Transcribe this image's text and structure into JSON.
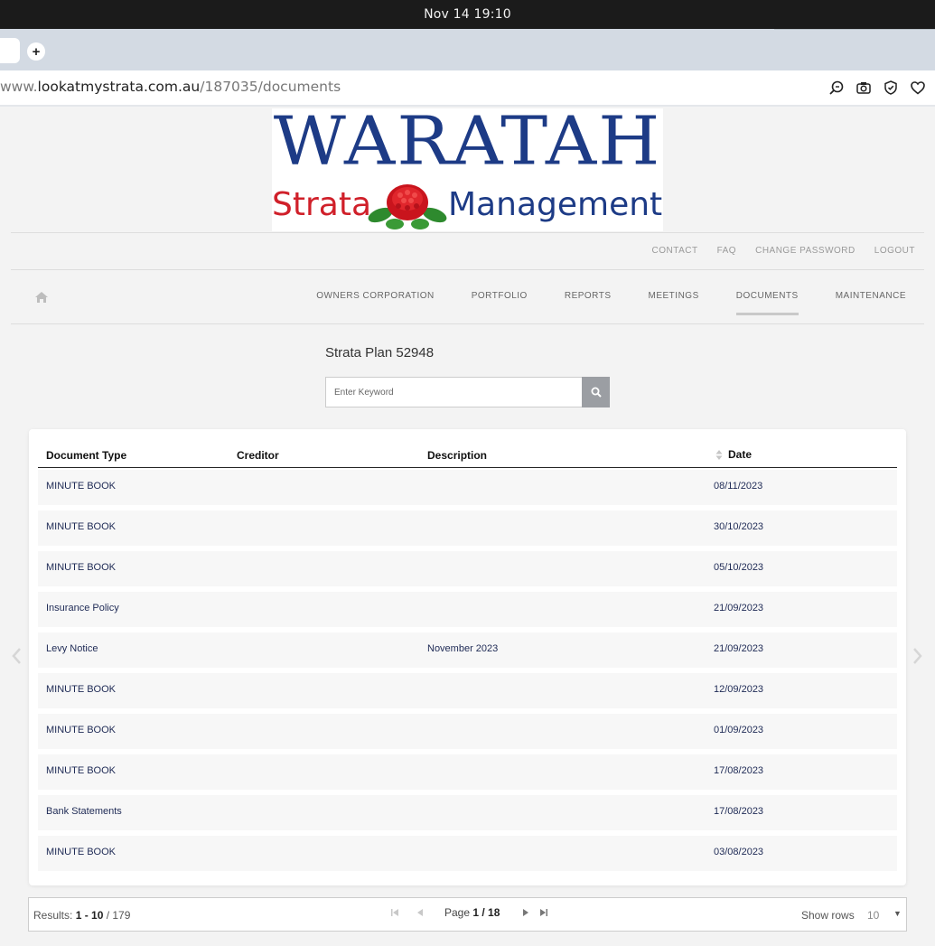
{
  "os": {
    "clock": "Nov 14  19:10"
  },
  "browser": {
    "new_tab_glyph": "+",
    "url_prefix": "www.",
    "url_host": "lookatmystrata.com.au",
    "url_path": "/187035/documents"
  },
  "logo": {
    "line1": "WARATAH",
    "strata": "Strata",
    "management": "Management"
  },
  "util_nav": [
    "CONTACT",
    "FAQ",
    "CHANGE PASSWORD",
    "LOGOUT"
  ],
  "main_nav": [
    "OWNERS CORPORATION",
    "PORTFOLIO",
    "REPORTS",
    "MEETINGS",
    "DOCUMENTS",
    "MAINTENANCE"
  ],
  "main_nav_active": "DOCUMENTS",
  "plan_title": "Strata Plan 52948",
  "search": {
    "placeholder": "Enter Keyword"
  },
  "table": {
    "headers": {
      "type": "Document Type",
      "creditor": "Creditor",
      "description": "Description",
      "date": "Date"
    },
    "rows": [
      {
        "type": "MINUTE BOOK",
        "creditor": "",
        "description": "",
        "date": "08/11/2023"
      },
      {
        "type": "MINUTE BOOK",
        "creditor": "",
        "description": "",
        "date": "30/10/2023"
      },
      {
        "type": "MINUTE BOOK",
        "creditor": "",
        "description": "",
        "date": "05/10/2023"
      },
      {
        "type": "Insurance Policy",
        "creditor": "",
        "description": "",
        "date": "21/09/2023"
      },
      {
        "type": "Levy Notice",
        "creditor": "",
        "description": "November 2023",
        "date": "21/09/2023"
      },
      {
        "type": "MINUTE BOOK",
        "creditor": "",
        "description": "",
        "date": "12/09/2023"
      },
      {
        "type": "MINUTE BOOK",
        "creditor": "",
        "description": "",
        "date": "01/09/2023"
      },
      {
        "type": "MINUTE BOOK",
        "creditor": "",
        "description": "",
        "date": "17/08/2023"
      },
      {
        "type": "Bank Statements",
        "creditor": "",
        "description": "",
        "date": "17/08/2023"
      },
      {
        "type": "MINUTE BOOK",
        "creditor": "",
        "description": "",
        "date": "03/08/2023"
      }
    ]
  },
  "pager": {
    "results_label": "Results: ",
    "results_range": "1 - 10",
    "results_total": " / 179",
    "page_label": "Page ",
    "page_value": "1 / 18",
    "show_rows_label": "Show rows",
    "rows_value": "10",
    "caret": "▼"
  },
  "colors": {
    "logo_blue": "#1d3b86",
    "logo_red": "#d0202a",
    "row_text": "#1e2a55"
  }
}
